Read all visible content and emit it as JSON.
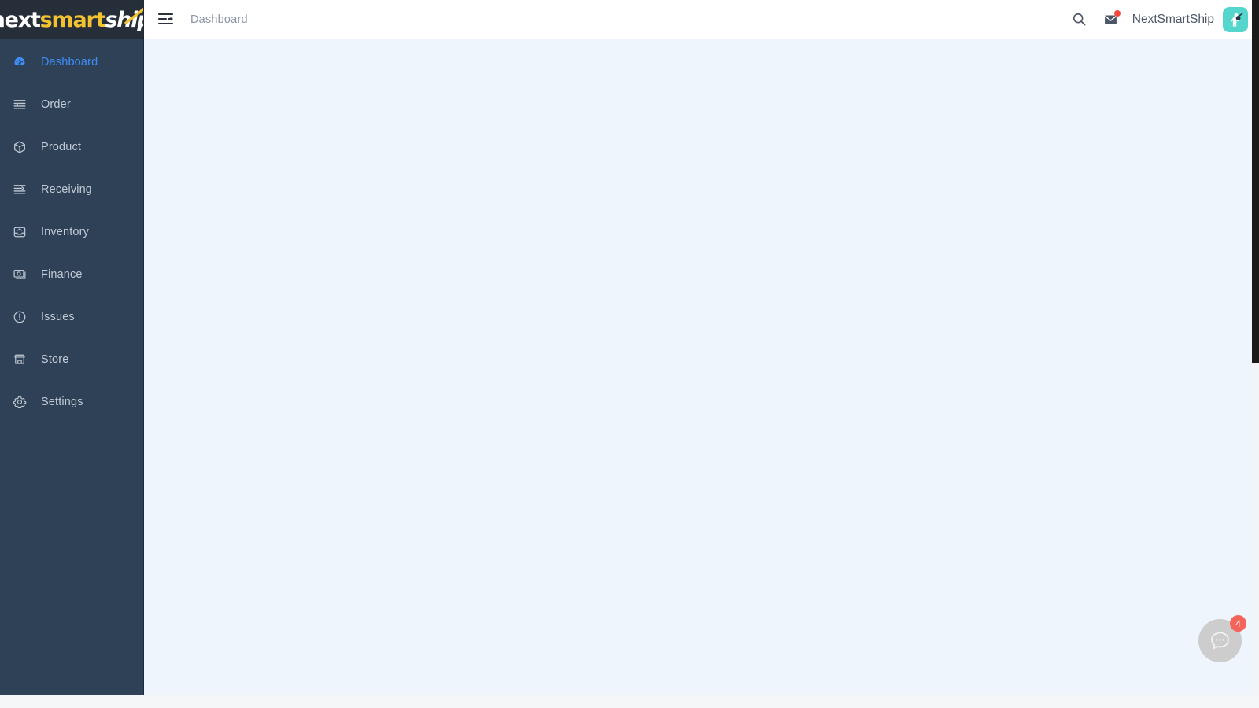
{
  "brand": {
    "logo_part1": "next",
    "logo_part2": "smart",
    "logo_part3": "ship",
    "logo_color_part1": "#ffffff",
    "logo_color_part2": "#f2c230",
    "logo_color_part3": "#ffffff",
    "sidebar_bg": "#2f4157",
    "logo_bg": "#262e3a",
    "accent_blue": "#3e8ef7",
    "content_bg": "#eef5fc",
    "avatar_bg": "#55d6cd",
    "badge_red": "#f4645a"
  },
  "sidebar": {
    "items": [
      {
        "label": "Dashboard",
        "icon": "dashboard-gauge-icon",
        "active": true
      },
      {
        "label": "Order",
        "icon": "order-list-icon",
        "active": false
      },
      {
        "label": "Product",
        "icon": "product-box-icon",
        "active": false
      },
      {
        "label": "Receiving",
        "icon": "receiving-list-icon",
        "active": false
      },
      {
        "label": "Inventory",
        "icon": "inventory-tray-icon",
        "active": false
      },
      {
        "label": "Finance",
        "icon": "finance-banknote-icon",
        "active": false
      },
      {
        "label": "Issues",
        "icon": "issues-alert-circle-icon",
        "active": false
      },
      {
        "label": "Store",
        "icon": "store-shop-icon",
        "active": false
      },
      {
        "label": "Settings",
        "icon": "settings-gear-icon",
        "active": false
      }
    ]
  },
  "topbar": {
    "collapse_icon": "sidebar-collapse-icon",
    "breadcrumb": "Dashboard",
    "search_icon": "search-icon",
    "mail_icon": "mail-envelope-icon",
    "mail_has_unread": true,
    "account_name": "NextSmartShip",
    "avatar_icon": "user-avatar-icon"
  },
  "content": {
    "body_text": ""
  },
  "chat": {
    "icon": "chat-bubble-icon",
    "badge_count": "4"
  },
  "scrollbars": {
    "vertical_visible": true,
    "horizontal_visible": true
  }
}
